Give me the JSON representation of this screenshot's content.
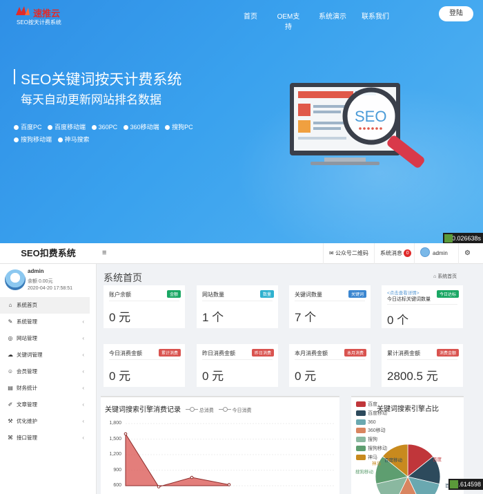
{
  "hero": {
    "logo_name": "速推云",
    "logo_sub": "SEO按天计费系统",
    "nav": [
      "首页",
      "OEM支持",
      "系统演示",
      "联系我们"
    ],
    "login": "登陆",
    "title": "SEO关键词按天计费系统",
    "subtitle": "每天自动更新网站排名数据",
    "platforms": [
      "百度PC",
      "百度移动端",
      "360PC",
      "360移动端",
      "搜狗PC",
      "搜狗移动端",
      "神马搜索"
    ],
    "illustration_text": "SEO",
    "timing_top": "0.026638s"
  },
  "admin": {
    "brand": "SEO扣费系统",
    "menu_toggle": "≡",
    "topbar": {
      "qr": "公众号二维码",
      "msgs": "系统消息",
      "msgs_count": "0",
      "user": "admin"
    },
    "user": {
      "name": "admin",
      "balance": "余额 0.00元",
      "time": "2020-04-20 17:58:51"
    },
    "menu": [
      {
        "label": "系统首页",
        "icon": "home-icon",
        "glyph": "⌂"
      },
      {
        "label": "系统管理",
        "icon": "wrench-icon",
        "glyph": "✎"
      },
      {
        "label": "网站管理",
        "icon": "globe-icon",
        "glyph": "◎"
      },
      {
        "label": "关键词管理",
        "icon": "cloud-icon",
        "glyph": "☁"
      },
      {
        "label": "会员管理",
        "icon": "users-icon",
        "glyph": "☺"
      },
      {
        "label": "财务统计",
        "icon": "chart-icon",
        "glyph": "▤"
      },
      {
        "label": "文章管理",
        "icon": "edit-icon",
        "glyph": "✐"
      },
      {
        "label": "优化维护",
        "icon": "tool-icon",
        "glyph": "⚒"
      },
      {
        "label": "接口管理",
        "icon": "plug-icon",
        "glyph": "⌘"
      }
    ],
    "page_title": "系统首页",
    "breadcrumb": "系统首页",
    "cards": [
      {
        "title": "账户余额",
        "tag": "金额",
        "value": "0 元",
        "tag_color": "#1aa764"
      },
      {
        "title": "网站数量",
        "tag": "数量",
        "value": "1 个",
        "tag_color": "#2fb1cf"
      },
      {
        "title": "关键词数量",
        "tag": "关键词",
        "value": "7 个",
        "tag_color": "#3b86d0"
      },
      {
        "title": "今日达标关键词数量",
        "tag": "今日达标",
        "value": "0 个",
        "tag_color": "#1aa764",
        "link": "<点击查看详情>"
      },
      {
        "title": "今日消费金额",
        "tag": "累计消费",
        "value": "0 元",
        "tag_color": "#d9534f"
      },
      {
        "title": "昨日消费金额",
        "tag": "昨日消费",
        "value": "0 元",
        "tag_color": "#d9534f"
      },
      {
        "title": "本月消费金额",
        "tag": "本月消费",
        "value": "0 元",
        "tag_color": "#d9534f"
      },
      {
        "title": "累计消费金额",
        "tag": "消费金额",
        "value": "2800.5 元",
        "tag_color": "#d9534f"
      }
    ],
    "timing_bottom": "0.614598",
    "line_panel": {
      "title": "关键词搜索引擎消费记录",
      "legend": [
        "总消费",
        "今日消费"
      ]
    },
    "pie_panel": {
      "title": "关键词搜索引擎占比",
      "slice_labels": [
        "百度",
        "百度移动",
        "神马",
        "搜狗移动",
        "百度PC"
      ]
    }
  },
  "chart_data": [
    {
      "type": "area",
      "title": "关键词搜索引擎消费记录",
      "series": [
        {
          "name": "总消费",
          "values": [
            1600,
            580,
            760,
            620
          ]
        }
      ],
      "yticks": [
        1800,
        1500,
        1200,
        900,
        600
      ],
      "ylim": [
        600,
        1800
      ],
      "color": "#d9534f"
    },
    {
      "type": "pie",
      "title": "关键词搜索引擎占比",
      "categories": [
        "百度",
        "百度移动",
        "360",
        "360移动",
        "搜狗",
        "搜狗移动",
        "神马"
      ],
      "colors": [
        "#c0363a",
        "#2d4a5c",
        "#6aa8b0",
        "#d98560",
        "#8ab8a0",
        "#5e9e70",
        "#c88a1e"
      ],
      "values": [
        14.3,
        14.3,
        14.3,
        14.3,
        14.3,
        14.3,
        14.2
      ]
    }
  ]
}
